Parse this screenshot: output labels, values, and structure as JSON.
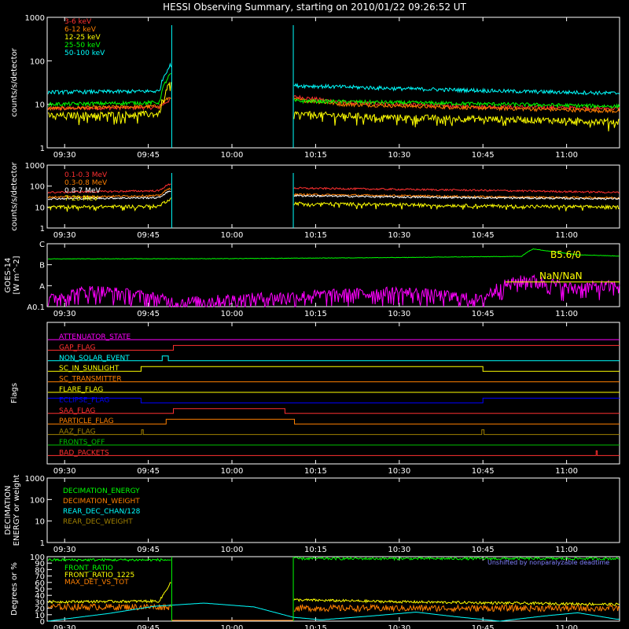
{
  "title": "HESSI Observing Summary, starting on 2010/01/22 09:26:52 UT",
  "time_axis": {
    "ticks": [
      "09:30",
      "09:45",
      "10:00",
      "10:15",
      "10:30",
      "10:45",
      "11:00"
    ],
    "tick_minutes": [
      30,
      45,
      60,
      75,
      90,
      105,
      120
    ],
    "range_minutes": [
      26.87,
      129.5
    ]
  },
  "colors": {
    "red": "#ff3030",
    "orange": "#ff8000",
    "yellow": "#ffff00",
    "green": "#00ff00",
    "cyan": "#00ffff",
    "magenta": "#ff00ff",
    "blue": "#0000ff",
    "olive": "#a08000",
    "darkgreen": "#00c000",
    "white": "#ffffff"
  },
  "chart_data": [
    {
      "type": "line",
      "panel": "low-energy",
      "ylabel": "counts/s/detector",
      "yscale": "log",
      "ylim": [
        1,
        1000
      ],
      "yticks": [
        "1",
        "10",
        "100",
        "1000"
      ],
      "yticks_values": [
        1,
        10,
        100,
        1000
      ],
      "data_gap_minutes": [
        49.2,
        71.0
      ],
      "series": [
        {
          "name": "3-6 keV",
          "color": "red",
          "values": [
            [
              27,
              8
            ],
            [
              47,
              8.5
            ],
            [
              49,
              13
            ],
            [
              71,
              15
            ],
            [
              80,
              11
            ],
            [
              100,
              9
            ],
            [
              129,
              8
            ]
          ]
        },
        {
          "name": "6-12 keV",
          "color": "orange",
          "values": [
            [
              27,
              8
            ],
            [
              47,
              9
            ],
            [
              49,
              15
            ],
            [
              71,
              13
            ],
            [
              80,
              10
            ],
            [
              100,
              8.5
            ],
            [
              129,
              7
            ]
          ]
        },
        {
          "name": "12-25 keV",
          "color": "yellow",
          "values": [
            [
              27,
              5.5
            ],
            [
              47,
              6
            ],
            [
              49,
              30
            ],
            [
              71,
              6
            ],
            [
              90,
              5
            ],
            [
              110,
              4.5
            ],
            [
              129,
              4
            ]
          ]
        },
        {
          "name": "25-50 keV",
          "color": "green",
          "values": [
            [
              27,
              10
            ],
            [
              47,
              11
            ],
            [
              49,
              50
            ],
            [
              71,
              12
            ],
            [
              90,
              11
            ],
            [
              110,
              10
            ],
            [
              129,
              9
            ]
          ]
        },
        {
          "name": "50-100 keV",
          "color": "cyan",
          "values": [
            [
              27,
              19
            ],
            [
              47,
              20
            ],
            [
              49,
              80
            ],
            [
              71,
              27
            ],
            [
              90,
              23
            ],
            [
              110,
              20
            ],
            [
              129,
              18
            ]
          ]
        }
      ]
    },
    {
      "type": "line",
      "panel": "high-energy",
      "ylabel": "counts/s/detector",
      "yscale": "log",
      "ylim": [
        1,
        1000
      ],
      "yticks": [
        "1",
        "10",
        "100",
        "1000"
      ],
      "yticks_values": [
        1,
        10,
        100,
        1000
      ],
      "data_gap_minutes": [
        49.2,
        71.0
      ],
      "series": [
        {
          "name": "0.1-0.3 MeV",
          "color": "red",
          "values": [
            [
              27,
              50
            ],
            [
              47,
              60
            ],
            [
              49,
              130
            ],
            [
              71,
              80
            ],
            [
              90,
              70
            ],
            [
              110,
              60
            ],
            [
              129,
              50
            ]
          ]
        },
        {
          "name": "0.3-0.8 MeV",
          "color": "orange",
          "values": [
            [
              27,
              30
            ],
            [
              47,
              35
            ],
            [
              49,
              80
            ],
            [
              71,
              40
            ],
            [
              90,
              35
            ],
            [
              110,
              30
            ],
            [
              129,
              28
            ]
          ]
        },
        {
          "name": "0.8-7 MeV",
          "color": "white",
          "values": [
            [
              27,
              25
            ],
            [
              47,
              28
            ],
            [
              49,
              60
            ],
            [
              71,
              35
            ],
            [
              90,
              30
            ],
            [
              110,
              27
            ],
            [
              129,
              25
            ]
          ]
        },
        {
          "name": "7-20 MeV",
          "color": "yellow",
          "values": [
            [
              27,
              10
            ],
            [
              47,
              11
            ],
            [
              49,
              25
            ],
            [
              71,
              15
            ],
            [
              90,
              13
            ],
            [
              110,
              11
            ],
            [
              129,
              10
            ]
          ]
        }
      ]
    },
    {
      "type": "line",
      "panel": "goes",
      "ylabel": "GOES-14",
      "ylabel2": "[W m^-2]",
      "yscale": "log",
      "yticks": [
        "A0.1",
        "A",
        "B",
        "C"
      ],
      "yticks_values": [
        1e-09,
        1e-08,
        1e-07,
        1e-06
      ],
      "ylim": [
        1e-09,
        1e-06
      ],
      "annotations": [
        "B5.6/0",
        "NaN/NaN"
      ],
      "series": [
        {
          "color": "green",
          "values": [
            [
              27,
              1.9e-07
            ],
            [
              60,
              1.95e-07
            ],
            [
              90,
              2.2e-07
            ],
            [
              112,
              2.5e-07
            ],
            [
              114,
              5.6e-07
            ],
            [
              118,
              4e-07
            ],
            [
              122,
              3e-07
            ],
            [
              129,
              2.6e-07
            ]
          ]
        },
        {
          "color": "magenta",
          "values": [
            [
              27,
              2e-09
            ],
            [
              35,
              6e-09
            ],
            [
              50,
              1.5e-09
            ],
            [
              70,
              3e-09
            ],
            [
              90,
              5e-09
            ],
            [
              105,
              2e-09
            ],
            [
              113,
              2e-08
            ],
            [
              120,
              8e-09
            ],
            [
              129,
              1e-08
            ]
          ]
        },
        {
          "color": "yellow",
          "values": [
            [
              109,
              1.5e-08
            ],
            [
              129.5,
              1.5e-08
            ]
          ]
        }
      ]
    },
    {
      "type": "line",
      "panel": "flags",
      "ylabel": "Flags",
      "series": [
        {
          "name": "ATTENUATOR_STATE",
          "color": "magenta",
          "values": [
            [
              27,
              0
            ],
            [
              129.5,
              0
            ]
          ]
        },
        {
          "name": "GAP_FLAG",
          "color": "red",
          "values": [
            [
              27,
              0
            ],
            [
              49.5,
              0
            ],
            [
              49.5,
              1
            ],
            [
              129.5,
              1
            ]
          ]
        },
        {
          "name": "NON_SOLAR_EVENT",
          "color": "cyan",
          "values": [
            [
              27,
              0
            ],
            [
              47.5,
              0
            ],
            [
              47.5,
              1
            ],
            [
              48.6,
              1
            ],
            [
              48.6,
              0
            ],
            [
              129.5,
              0
            ]
          ]
        },
        {
          "name": "SC_IN_SUNLIGHT",
          "color": "yellow",
          "values": [
            [
              27,
              0
            ],
            [
              43.7,
              0
            ],
            [
              43.7,
              1
            ],
            [
              105,
              1
            ],
            [
              105,
              0
            ],
            [
              129.5,
              0
            ]
          ]
        },
        {
          "name": "SC_TRANSMITTER",
          "color": "orange",
          "values": [
            [
              27,
              0
            ],
            [
              129.5,
              0
            ]
          ]
        },
        {
          "name": "FLARE_FLAG",
          "color": "yellow",
          "values": [
            [
              27,
              0
            ],
            [
              129.5,
              0
            ]
          ]
        },
        {
          "name": "ECLIPSE_FLAG",
          "color": "blue",
          "values": [
            [
              27,
              1
            ],
            [
              43.7,
              1
            ],
            [
              43.7,
              0
            ],
            [
              105,
              0
            ],
            [
              105,
              1
            ],
            [
              129.5,
              1
            ]
          ]
        },
        {
          "name": "SAA_FLAG",
          "color": "red",
          "values": [
            [
              27,
              0
            ],
            [
              49.5,
              0
            ],
            [
              49.5,
              1
            ],
            [
              69.5,
              1
            ],
            [
              69.5,
              0
            ],
            [
              129.5,
              0
            ]
          ]
        },
        {
          "name": "PARTICLE_FLAG",
          "color": "orange",
          "values": [
            [
              27,
              0
            ],
            [
              48.2,
              0
            ],
            [
              48.2,
              1
            ],
            [
              71.2,
              1
            ],
            [
              71.2,
              0
            ],
            [
              129.5,
              0
            ]
          ]
        },
        {
          "name": "AAZ_FLAG",
          "color": "olive",
          "values": [
            [
              27,
              0
            ],
            [
              43.8,
              0
            ],
            [
              43.8,
              1
            ],
            [
              44.1,
              1
            ],
            [
              44.1,
              0
            ],
            [
              104.8,
              0
            ],
            [
              104.8,
              1
            ],
            [
              105.2,
              1
            ],
            [
              105.2,
              0
            ],
            [
              129.5,
              0
            ]
          ]
        },
        {
          "name": "FRONTS_OFF",
          "color": "darkgreen",
          "values": [
            [
              27,
              0
            ],
            [
              129.5,
              0
            ]
          ]
        },
        {
          "name": "BAD_PACKETS",
          "color": "red",
          "values": [
            [
              27,
              0
            ],
            [
              125.3,
              0
            ],
            [
              125.3,
              1
            ],
            [
              125.5,
              1
            ],
            [
              125.5,
              0
            ],
            [
              129.5,
              0
            ]
          ]
        }
      ]
    },
    {
      "type": "line",
      "panel": "decimation",
      "ylabel": "DECIMATION",
      "ylabel2": "ENERGY or weight",
      "yscale": "log",
      "ylim": [
        1,
        1000
      ],
      "yticks": [
        "1",
        "10",
        "100",
        "1000"
      ],
      "yticks_values": [
        1,
        10,
        100,
        1000
      ],
      "series": [
        {
          "name": "DECIMATION_ENERGY",
          "color": "green",
          "values": []
        },
        {
          "name": "DECIMATION_WEIGHT",
          "color": "orange",
          "values": []
        },
        {
          "name": "REAR_DEC_CHAN/128",
          "color": "cyan",
          "values": []
        },
        {
          "name": "REAR_DEC_WEIGHT",
          "color": "olive",
          "values": []
        }
      ]
    },
    {
      "type": "line",
      "panel": "livetime",
      "ylabel": "Degrees or %",
      "ylim": [
        0,
        100
      ],
      "yticks": [
        "0",
        "10",
        "20",
        "30",
        "40",
        "50",
        "60",
        "70",
        "80",
        "90",
        "100"
      ],
      "yticks_values": [
        0,
        10,
        20,
        30,
        40,
        50,
        60,
        70,
        80,
        90,
        100
      ],
      "annotations": [
        "Unshifted by nonparalyzable deadtime"
      ],
      "data_gap_minutes": [
        49.2,
        71.0
      ],
      "series": [
        {
          "name": "FRONT_RATIO",
          "color": "green",
          "values": [
            [
              27,
              95
            ],
            [
              49,
              95
            ],
            [
              71,
              97
            ],
            [
              129,
              97
            ]
          ]
        },
        {
          "name": "FRONT_RATIO_1225",
          "color": "yellow",
          "values": [
            [
              27,
              30
            ],
            [
              47,
              31
            ],
            [
              49,
              60
            ],
            [
              71,
              33
            ],
            [
              90,
              30
            ],
            [
              129,
              26
            ]
          ]
        },
        {
          "name": "MAX_DET_VS_TOT",
          "color": "orange",
          "values": [
            [
              27,
              22
            ],
            [
              49,
              22
            ],
            [
              71,
              20
            ],
            [
              129,
              20
            ]
          ]
        },
        {
          "name": "",
          "color": "cyan",
          "values": [
            [
              27,
              0
            ],
            [
              38,
              12
            ],
            [
              46,
              23
            ],
            [
              55,
              28
            ],
            [
              64,
              22
            ],
            [
              71,
              6
            ],
            [
              76,
              2
            ],
            [
              85,
              8
            ],
            [
              93,
              14
            ],
            [
              100,
              7
            ],
            [
              108,
              0
            ],
            [
              116,
              8
            ],
            [
              122,
              13
            ],
            [
              129,
              3
            ]
          ]
        }
      ]
    }
  ]
}
